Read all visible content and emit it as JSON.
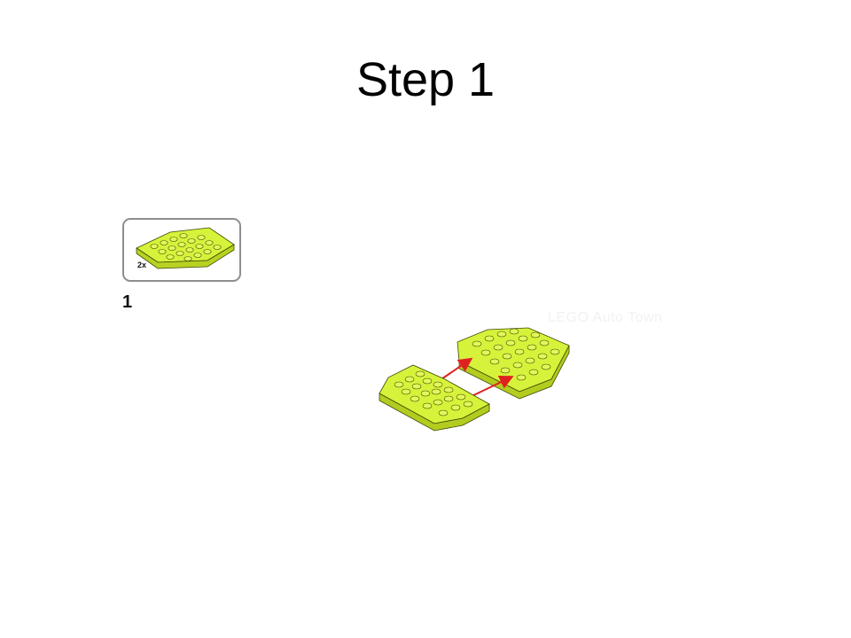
{
  "slide": {
    "title": "Step 1"
  },
  "instruction": {
    "step_number": "1",
    "parts_callout": {
      "quantity": "2x",
      "part_icon": "wedge-plate-4x6-icon"
    },
    "assembly_icon": "two-wedge-plates-joining-icon",
    "watermark": "LEGO Auto Town"
  },
  "colors": {
    "brick": "#d7f23a",
    "brick_shadow": "#a9c01a",
    "outline": "#3c4a05",
    "arrow": "#e02020",
    "box_border": "#8e8e8e"
  }
}
